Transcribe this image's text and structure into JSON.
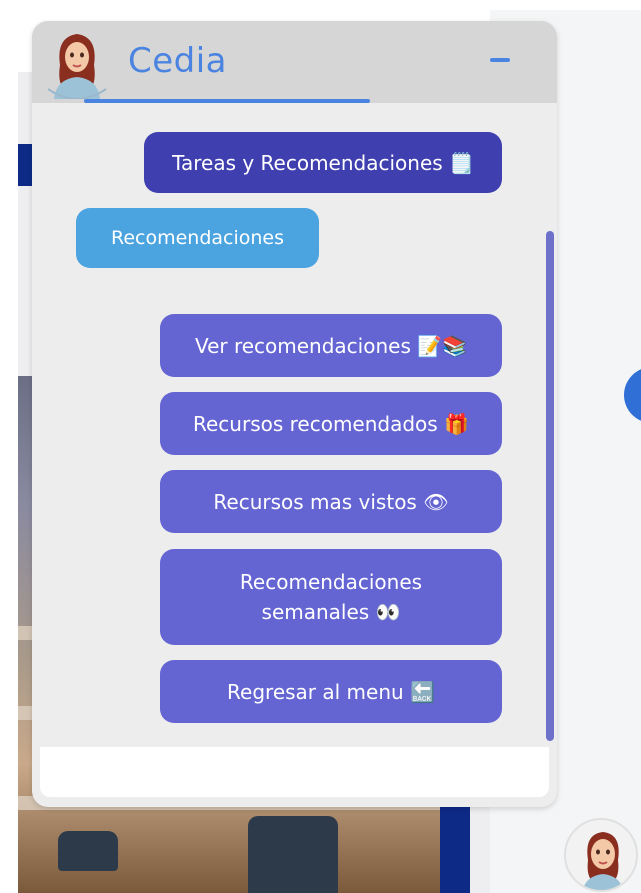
{
  "chat": {
    "title": "Cedia",
    "messages": {
      "user_selection": "Tareas y Recomendaciones 🗒️",
      "bot_reply": "Recomendaciones"
    },
    "options": [
      {
        "label": "Ver recomendaciones 📝📚"
      },
      {
        "label": "Recursos recomendados 🎁"
      },
      {
        "label": "Recursos mas vistos 👁"
      },
      {
        "label": "Recomendaciones semanales 👀"
      },
      {
        "label": "Regresar al menu 🔙"
      }
    ],
    "input": {
      "value": "",
      "placeholder": ""
    }
  },
  "colors": {
    "header_bg": "#d6d6d6",
    "title_blue": "#4a84e0",
    "user_bubble": "#3f3fb0",
    "bot_bubble": "#4ba3e0",
    "option_button": "#6465d3",
    "panel_bg": "#ededed"
  },
  "icons": {
    "header_avatar": "assistant-avatar-icon",
    "minimize": "minimize-icon",
    "floating_avatar": "assistant-avatar-icon"
  }
}
